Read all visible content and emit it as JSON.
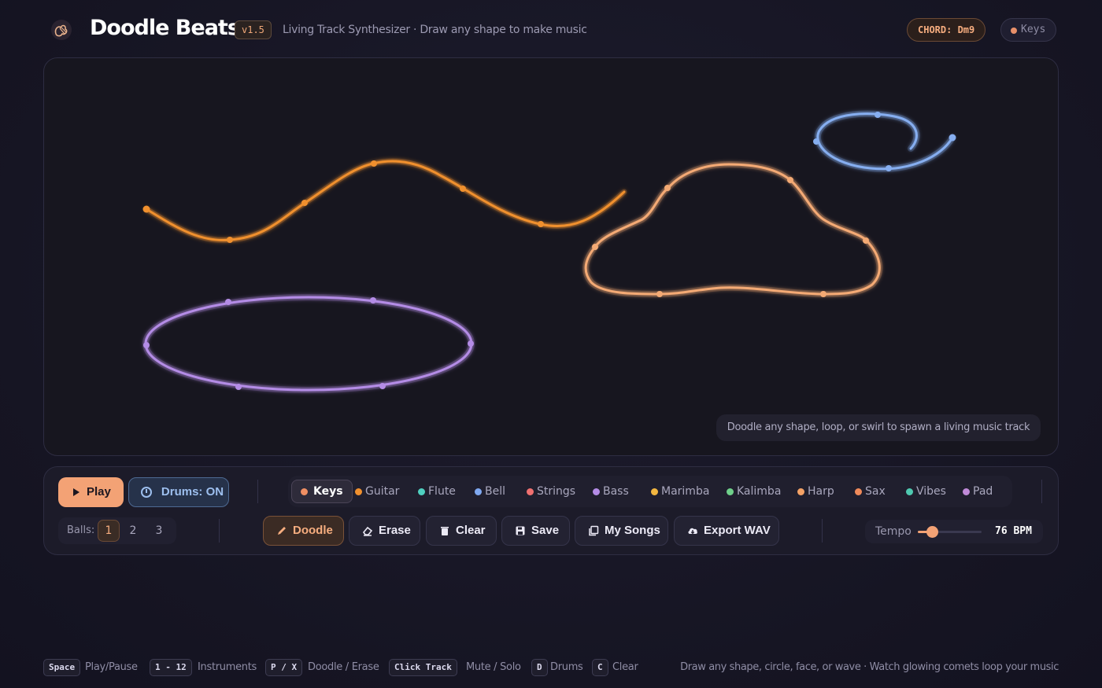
{
  "header": {
    "title": "Doodle Beats",
    "version": "v1.5",
    "subtitle": "Living Track Synthesizer · Draw any shape to make music",
    "chord": "CHORD: Dm9",
    "active_instrument": "Keys",
    "logo_icon": "hand-drawn-guitar-logo"
  },
  "canvas": {
    "hint": "Doodle any shape, loop, or swirl to spawn a living music track",
    "tracks": [
      {
        "instrument": "Guitar",
        "color": "#f0902e",
        "shape": "wave"
      },
      {
        "instrument": "Harp",
        "color": "#f4aa74",
        "shape": "cloud"
      },
      {
        "instrument": "Bell",
        "color": "#86aef0",
        "shape": "spiral"
      },
      {
        "instrument": "Bass",
        "color": "#b48ce6",
        "shape": "ellipse"
      }
    ]
  },
  "transport": {
    "play_label": "Play",
    "drums_label": "Drums: ON"
  },
  "instruments": [
    {
      "label": "Keys",
      "color": "#f08f63",
      "active": true
    },
    {
      "label": "Guitar",
      "color": "#f0902e",
      "active": false
    },
    {
      "label": "Flute",
      "color": "#4fd0c0",
      "active": false
    },
    {
      "label": "Bell",
      "color": "#7fa8f0",
      "active": false
    },
    {
      "label": "Strings",
      "color": "#f07070",
      "active": false
    },
    {
      "label": "Bass",
      "color": "#b48ce6",
      "active": false
    },
    {
      "label": "Marimba",
      "color": "#f2b640",
      "active": false
    },
    {
      "label": "Kalimba",
      "color": "#6fd08a",
      "active": false
    },
    {
      "label": "Harp",
      "color": "#f4a266",
      "active": false
    },
    {
      "label": "Sax",
      "color": "#f08a5a",
      "active": false
    },
    {
      "label": "Vibes",
      "color": "#4fc9b0",
      "active": false
    },
    {
      "label": "Pad",
      "color": "#c08ad8",
      "active": false
    }
  ],
  "balls": {
    "label": "Balls:",
    "options": [
      "1",
      "2",
      "3"
    ],
    "selected": "1"
  },
  "tools": {
    "doodle": "Doodle",
    "erase": "Erase",
    "clear": "Clear",
    "save": "Save",
    "my_songs": "My Songs",
    "export": "Export WAV"
  },
  "tempo": {
    "label": "Tempo",
    "bpm": 76,
    "value_text": "76 BPM",
    "min": 40,
    "max": 200
  },
  "footer": {
    "shortcuts": [
      {
        "key": "Space",
        "label": "Play/Pause"
      },
      {
        "key": "1 - 12",
        "label": "Instruments"
      },
      {
        "key": "P / X",
        "label": "Doodle / Erase"
      },
      {
        "key": "Click Track",
        "label": "Mute / Solo"
      },
      {
        "key": "D",
        "label": "Drums"
      },
      {
        "key": "C",
        "label": "Clear"
      }
    ],
    "note": "Draw any shape, circle, face, or wave · Watch glowing comets loop your music"
  },
  "colors": {
    "accent": "#f3a275",
    "drums": "#9dbfee",
    "background": "#181727"
  }
}
